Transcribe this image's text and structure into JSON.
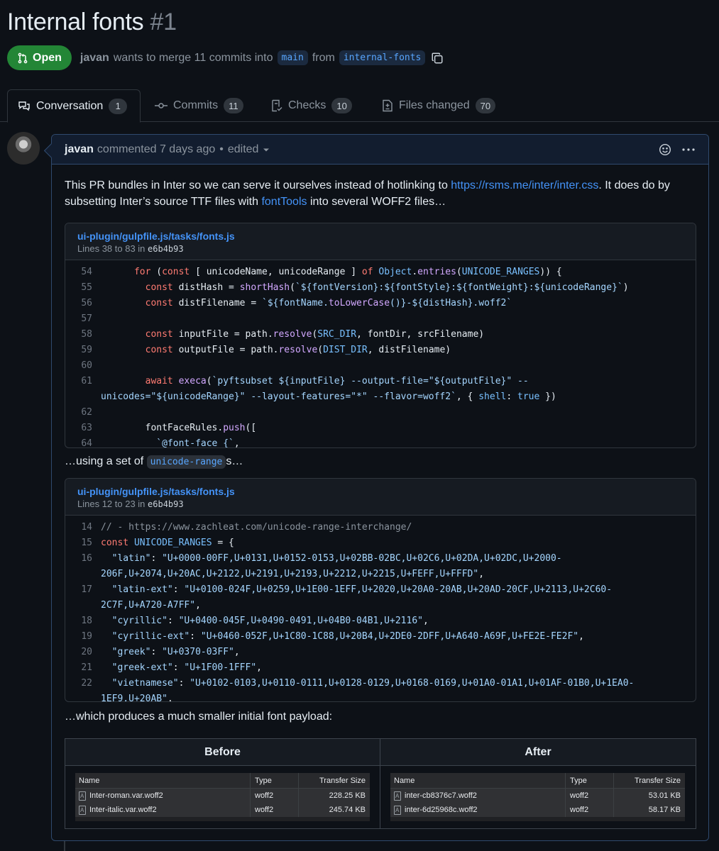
{
  "pr": {
    "title": "Internal fonts",
    "number": "#1",
    "state": "Open",
    "author": "javan",
    "merge_text": "wants to merge 11 commits into",
    "base_branch": "main",
    "from_text": "from",
    "head_branch": "internal-fonts"
  },
  "tabs": [
    {
      "label": "Conversation",
      "count": "1"
    },
    {
      "label": "Commits",
      "count": "11"
    },
    {
      "label": "Checks",
      "count": "10"
    },
    {
      "label": "Files changed",
      "count": "70"
    }
  ],
  "comment": {
    "author": "javan",
    "action": "commented 7 days ago",
    "separator": "•",
    "edited": "edited",
    "intro_1": "This PR bundles in Inter so we can serve it ourselves instead of hotlinking to ",
    "intro_link": "https://rsms.me/inter/inter.css",
    "intro_2": ". It does do by",
    "intro_3": "subsetting Inter’s source TTF files with ",
    "intro_link2": "fontTools",
    "intro_4": " into several WOFF2 files…",
    "middle_1": "…using a set of ",
    "middle_code": "unicode-range",
    "middle_2": "s…",
    "closing": "…which produces a much smaller initial font payload:"
  },
  "snippet1": {
    "path": "ui-plugin/gulpfile.js/tasks/fonts.js",
    "lines_label": "Lines 38 to 83 in",
    "sha": "e6b4b93",
    "line_numbers": [
      "54",
      "55",
      "56",
      "57",
      "58",
      "59",
      "60",
      "61",
      "",
      "62",
      "63",
      "64"
    ]
  },
  "snippet2": {
    "path": "ui-plugin/gulpfile.js/tasks/fonts.js",
    "lines_label": "Lines 12 to 23 in",
    "sha": "e6b4b93",
    "line_numbers": [
      "14",
      "15",
      "16",
      "",
      "17",
      "",
      "18",
      "19",
      "20",
      "21",
      "22",
      ""
    ]
  },
  "compare": {
    "before_label": "Before",
    "after_label": "After",
    "col_name": "Name",
    "col_type": "Type",
    "col_size": "Transfer Size",
    "before_rows": [
      {
        "name": "Inter-roman.var.woff2",
        "type": "woff2",
        "size": "228.25 KB"
      },
      {
        "name": "Inter-italic.var.woff2",
        "type": "woff2",
        "size": "245.74 KB"
      }
    ],
    "after_rows": [
      {
        "name": "inter-cb8376c7.woff2",
        "type": "woff2",
        "size": "53.01 KB"
      },
      {
        "name": "inter-6d25968c.woff2",
        "type": "woff2",
        "size": "58.17 KB"
      }
    ]
  },
  "icons": [
    "git-pull-request-icon",
    "copy-icon",
    "comment-discussion-icon",
    "git-commit-icon",
    "checklist-icon",
    "file-diff-icon",
    "smiley-icon",
    "kebab-horizontal-icon",
    "triangle-down-icon",
    "file-font-icon"
  ],
  "colors": {
    "open_green": "#238636",
    "accent_link": "#4493f8",
    "background": "#0d1117"
  }
}
